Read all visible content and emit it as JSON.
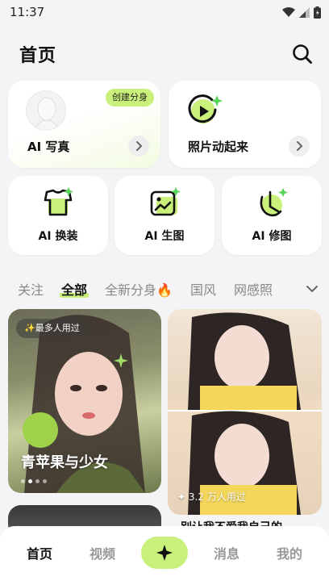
{
  "status_bar": {
    "time": "11:37"
  },
  "header": {
    "title": "首页"
  },
  "feature_cards": {
    "ai_portrait": {
      "label": "AI 写真",
      "badge": "创建分身"
    },
    "photo_animate": {
      "label": "照片动起来"
    },
    "outfit": {
      "label": "AI 换装"
    },
    "image_gen": {
      "label": "AI 生图"
    },
    "retouch": {
      "label": "AI 修图"
    }
  },
  "tabs": [
    "关注",
    "全部",
    "全新分身🔥",
    "国风",
    "网感照"
  ],
  "active_tab": "全部",
  "feed": {
    "left": {
      "badge": "✨最多人用过",
      "title": "青苹果与少女"
    },
    "right": {
      "users": "✦ 3.2 万人用过",
      "caption": "别让我不爱我自己的..."
    }
  },
  "bottom_nav": {
    "home": "首页",
    "video": "视频",
    "messages": "消息",
    "me": "我的"
  },
  "colors": {
    "accent": "#c8f07a",
    "background": "#f4f4f6"
  }
}
